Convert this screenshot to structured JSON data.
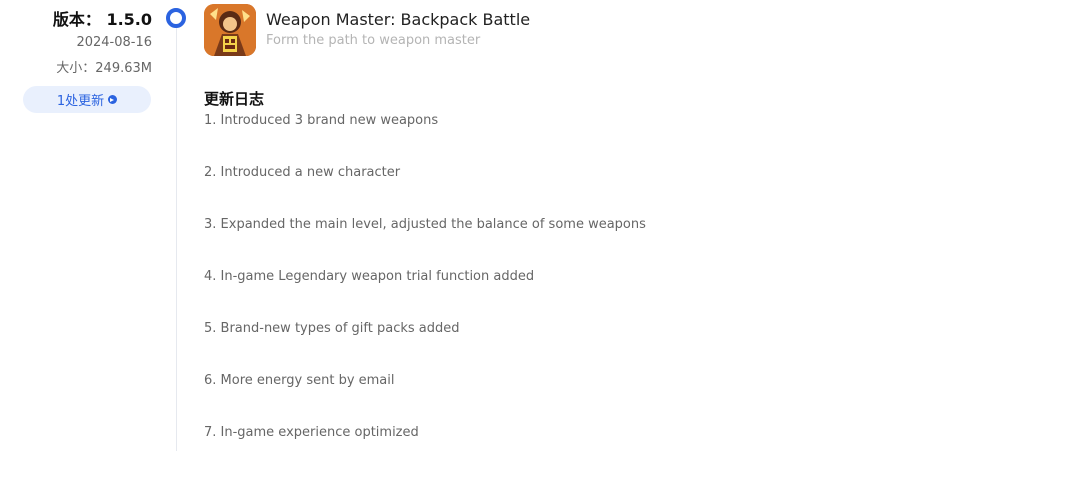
{
  "version": {
    "label": "版本：",
    "number": "1.5.0",
    "date": "2024-08-16",
    "size": "大小：249.63M",
    "updates_button": "1处更新"
  },
  "app": {
    "title": "Weapon Master: Backpack Battle",
    "subtitle": "Form the path to weapon master"
  },
  "changelog": {
    "heading": "更新日志",
    "items": [
      "1. Introduced 3 brand new weapons",
      "2. Introduced a new character",
      "3. Expanded the main level, adjusted the balance of some weapons",
      "4. In-game Legendary weapon trial function added",
      "5. Brand-new types of gift packs added",
      "6. More energy sent by email",
      "7. In-game experience optimized"
    ]
  },
  "colors": {
    "accent": "#2b63e0",
    "accent_bg": "#e9f0fd",
    "muted_text": "#666666",
    "subtitle_text": "#b4b4b4"
  },
  "icons": [
    "timeline-dot-icon",
    "arrow-circle-right-icon",
    "app-icon"
  ]
}
